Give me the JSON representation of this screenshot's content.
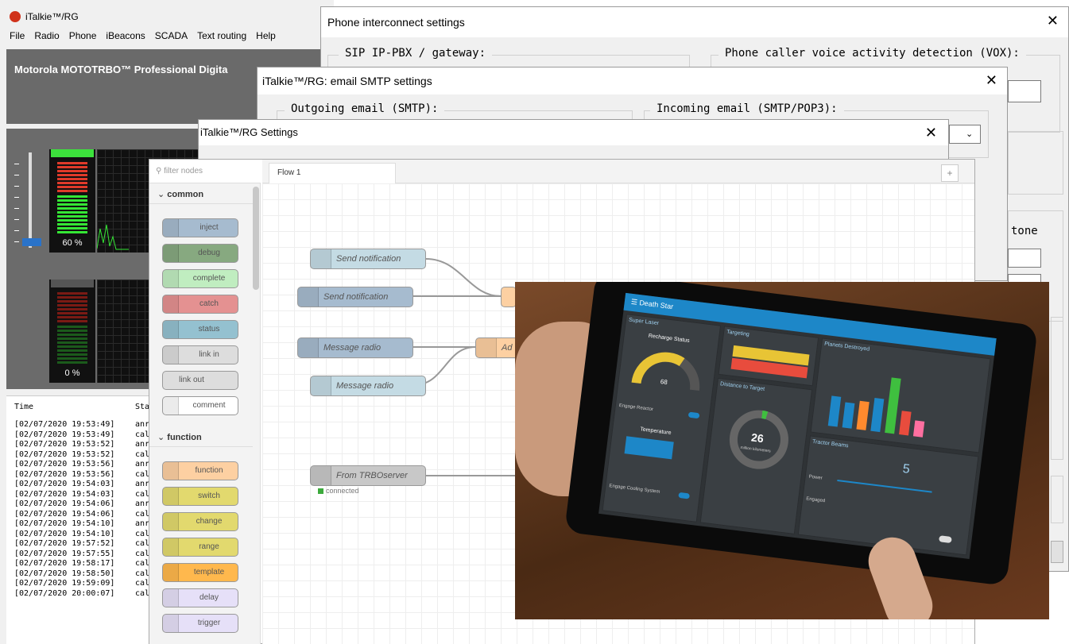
{
  "main": {
    "title": "iTalkie™/RG",
    "menu": [
      "File",
      "Radio",
      "Phone",
      "iBeacons",
      "SCADA",
      "Text routing",
      "Help"
    ],
    "banner": "Motorola MOTOTRBO™ Professional Digita",
    "meter1_label": "60 %",
    "meter2_label": "0 %",
    "log_headers": [
      "Time",
      "Sta"
    ],
    "log_rows": [
      [
        "[02/07/2020 19:53:49]",
        "anr"
      ],
      [
        "[02/07/2020 19:53:49]",
        "cal"
      ],
      [
        "[02/07/2020 19:53:52]",
        "anr"
      ],
      [
        "[02/07/2020 19:53:52]",
        "cal"
      ],
      [
        "[02/07/2020 19:53:56]",
        "anr"
      ],
      [
        "[02/07/2020 19:53:56]",
        "cal"
      ],
      [
        "[02/07/2020 19:54:03]",
        "anr"
      ],
      [
        "[02/07/2020 19:54:03]",
        "cal"
      ],
      [
        "[02/07/2020 19:54:06]",
        "anr"
      ],
      [
        "[02/07/2020 19:54:06]",
        "cal"
      ],
      [
        "[02/07/2020 19:54:10]",
        "anr"
      ],
      [
        "[02/07/2020 19:54:10]",
        "cal"
      ],
      [
        "[02/07/2020 19:57:52]",
        "cal"
      ],
      [
        "[02/07/2020 19:57:55]",
        "cal"
      ],
      [
        "[02/07/2020 19:58:17]",
        "cal"
      ],
      [
        "[02/07/2020 19:58:50]",
        "cal"
      ],
      [
        "[02/07/2020 19:59:09]",
        "cal"
      ],
      [
        "[02/07/2020 20:00:07]",
        "call: from r"
      ]
    ]
  },
  "phone_dialog": {
    "title": "Phone interconnect settings",
    "close": "✕",
    "sip_group": "SIP IP-PBX / gateway:",
    "vox_group": "Phone caller voice activity detection (VOX):",
    "tone_label": "tone"
  },
  "email_dialog": {
    "title": "iTalkie™/RG: email SMTP settings",
    "close": "✕",
    "outgoing_group": "Outgoing email (SMTP):",
    "incoming_group": "Incoming email (SMTP/POP3):"
  },
  "settings_dialog": {
    "title": "iTalkie™/RG Settings",
    "close": "✕"
  },
  "nodered": {
    "search_placeholder": "filter nodes",
    "tab": "Flow 1",
    "add_tab": "+",
    "categories": [
      "common",
      "function"
    ],
    "common_nodes": [
      "inject",
      "debug",
      "complete",
      "catch",
      "status",
      "link in",
      "link out",
      "comment"
    ],
    "function_nodes": [
      "function",
      "switch",
      "change",
      "range",
      "template",
      "delay",
      "trigger"
    ],
    "flow_nodes": [
      "Send notification",
      "Send notification",
      "Message radio",
      "Message radio",
      "From TRBOserver"
    ],
    "flow_status": "connected",
    "partial_node": "Ad"
  },
  "tablet": {
    "dashboard_title": "Death Star",
    "cards": [
      "Super Laser",
      "Targeting",
      "Planets Destroyed",
      "Distance to Target",
      "Tractor Beams"
    ],
    "gauge_label": "Recharge Status",
    "gauge_value": "68",
    "temperature_label": "Temperature",
    "engage_reactor": "Engage Reactor",
    "engage_cooling": "Engage Cooling System",
    "distance_value": "26",
    "distance_unit": "million kilometers",
    "tractor_value": "5",
    "power_label": "Power",
    "engaged_label": "Engaged",
    "colors": {
      "header": "#1d87c8",
      "gauge": "#e8c435",
      "alert": "#e84c3d",
      "ring": "#3fbf3f"
    }
  }
}
